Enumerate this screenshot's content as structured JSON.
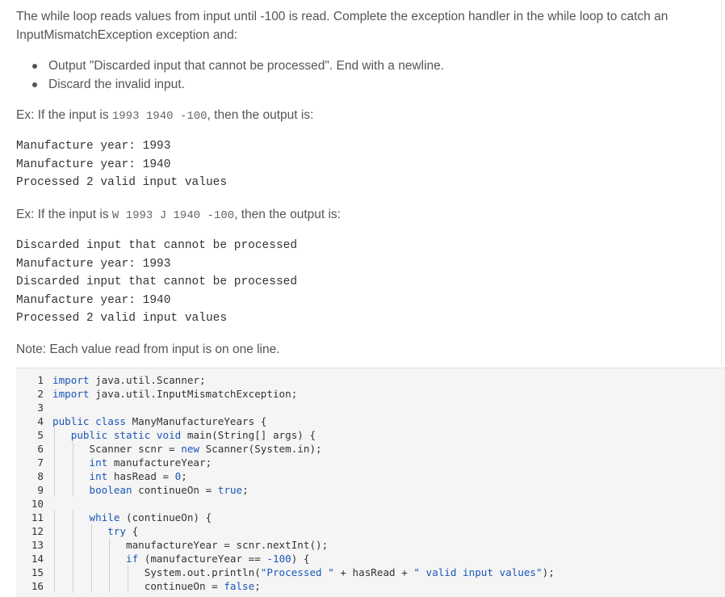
{
  "intro": {
    "line1": "The while loop reads values from input until -100 is read. Complete the exception handler in the while loop to catch an",
    "line2": "InputMismatchException exception and:"
  },
  "bullets": [
    "Output \"Discarded input that cannot be processed\". End with a newline.",
    "Discard the invalid input."
  ],
  "example1": {
    "prefix": "Ex: If the input is ",
    "input": "1993 1940 -100",
    "suffix": ", then the output is:",
    "output": "Manufacture year: 1993\nManufacture year: 1940\nProcessed 2 valid input values"
  },
  "example2": {
    "prefix": "Ex: If the input is ",
    "input": "W 1993 J 1940 -100",
    "suffix": ", then the output is:",
    "output": "Discarded input that cannot be processed\nManufacture year: 1993\nDiscarded input that cannot be processed\nManufacture year: 1940\nProcessed 2 valid input values"
  },
  "note": "Note: Each value read from input is on one line.",
  "editor": {
    "lines": [
      {
        "n": "1",
        "tokens": [
          [
            "kw",
            "import"
          ],
          [
            "code",
            " java.util.Scanner;"
          ]
        ]
      },
      {
        "n": "2",
        "tokens": [
          [
            "kw",
            "import"
          ],
          [
            "code",
            " java.util.InputMismatchException;"
          ]
        ]
      },
      {
        "n": "3",
        "tokens": []
      },
      {
        "n": "4",
        "tokens": [
          [
            "kw",
            "public class"
          ],
          [
            "code",
            " ManyManufactureYears {"
          ]
        ]
      },
      {
        "n": "5",
        "tokens": [
          [
            "code",
            "   "
          ],
          [
            "kw",
            "public static void"
          ],
          [
            "code",
            " main(String[] args) {"
          ]
        ]
      },
      {
        "n": "6",
        "tokens": [
          [
            "code",
            "      Scanner scnr = "
          ],
          [
            "kw",
            "new"
          ],
          [
            "code",
            " Scanner(System.in);"
          ]
        ]
      },
      {
        "n": "7",
        "tokens": [
          [
            "code",
            "      "
          ],
          [
            "kw",
            "int"
          ],
          [
            "code",
            " manufactureYear;"
          ]
        ]
      },
      {
        "n": "8",
        "tokens": [
          [
            "code",
            "      "
          ],
          [
            "kw",
            "int"
          ],
          [
            "code",
            " hasRead = "
          ],
          [
            "num",
            "0"
          ],
          [
            "code",
            ";"
          ]
        ]
      },
      {
        "n": "9",
        "tokens": [
          [
            "code",
            "      "
          ],
          [
            "kw",
            "boolean"
          ],
          [
            "code",
            " continueOn = "
          ],
          [
            "lit",
            "true"
          ],
          [
            "code",
            ";"
          ]
        ]
      },
      {
        "n": "10",
        "tokens": []
      },
      {
        "n": "11",
        "tokens": [
          [
            "code",
            "      "
          ],
          [
            "kw",
            "while"
          ],
          [
            "code",
            " (continueOn) {"
          ]
        ]
      },
      {
        "n": "12",
        "tokens": [
          [
            "code",
            "         "
          ],
          [
            "kw",
            "try"
          ],
          [
            "code",
            " {"
          ]
        ]
      },
      {
        "n": "13",
        "tokens": [
          [
            "code",
            "            manufactureYear = scnr.nextInt();"
          ]
        ]
      },
      {
        "n": "14",
        "tokens": [
          [
            "code",
            "            "
          ],
          [
            "kw",
            "if"
          ],
          [
            "code",
            " (manufactureYear == "
          ],
          [
            "num",
            "-100"
          ],
          [
            "code",
            ") {"
          ]
        ]
      },
      {
        "n": "15",
        "tokens": [
          [
            "code",
            "               System.out.println("
          ],
          [
            "str",
            "\"Processed \""
          ],
          [
            "code",
            " + hasRead + "
          ],
          [
            "str",
            "\" valid input values\""
          ],
          [
            "code",
            ");"
          ]
        ]
      },
      {
        "n": "16",
        "tokens": [
          [
            "code",
            "               continueOn = "
          ],
          [
            "lit",
            "false"
          ],
          [
            "code",
            ";"
          ]
        ]
      }
    ]
  }
}
